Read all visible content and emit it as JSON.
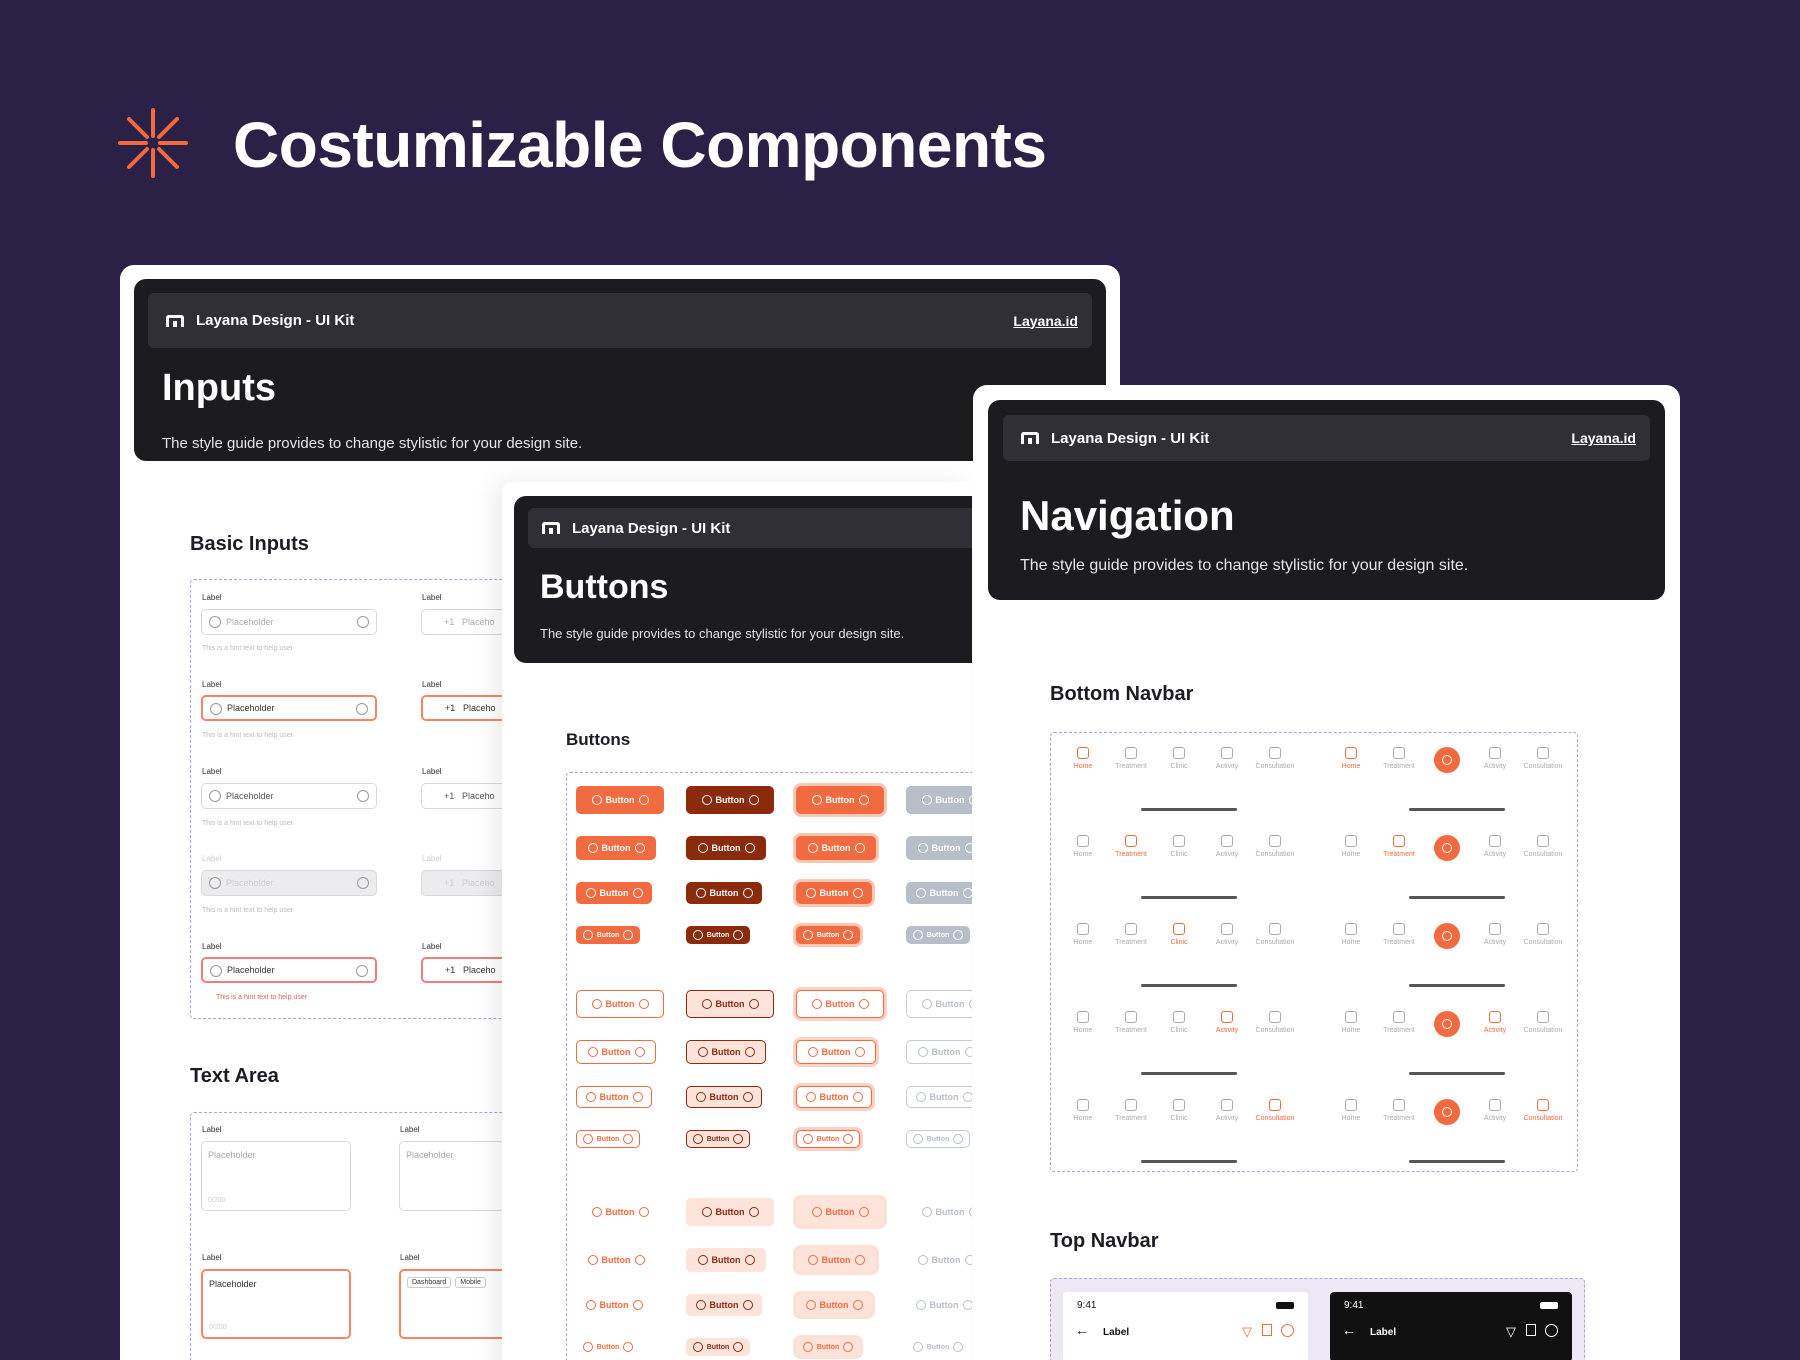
{
  "hero": {
    "title": "Costumizable Components"
  },
  "brand": "Layana Design - UI Kit",
  "brand_link": "Layana.id",
  "inputs_card": {
    "title": "Inputs",
    "subtitle": "The style guide provides to change stylistic for your design site.",
    "basic_inputs": "Basic Inputs",
    "text_area": "Text Area",
    "label": "Label",
    "placeholder": "Placeholder",
    "hint": "This is a hint text to help user",
    "phone_code": "+1",
    "phone_placeholder": "Placeho",
    "ta_counter": "0/200",
    "chip_1": "Dashboard",
    "chip_2": "Mobile"
  },
  "buttons_card": {
    "title": "Buttons",
    "subtitle": "The style guide provides to change stylistic for your design site.",
    "section": "Buttons",
    "button_label": "Button"
  },
  "nav_card": {
    "title": "Navigation",
    "subtitle": "The style guide provides to change stylistic for your design site.",
    "bottom_navbar": "Bottom Navbar",
    "top_navbar": "Top Navbar",
    "items": [
      "Home",
      "Treatment",
      "Clinic",
      "Activity",
      "Consultation"
    ],
    "time": "9:41",
    "top_label": "Label"
  },
  "colors": {
    "bg": "#2b2146",
    "accent": "#f26a3f",
    "dark": "#8c2a0c",
    "header": "#1c1b20"
  }
}
